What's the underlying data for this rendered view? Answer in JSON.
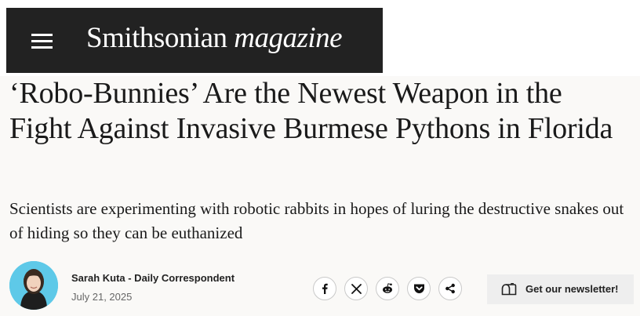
{
  "header": {
    "logo_main": "Smithsonian",
    "logo_sub": "magazine"
  },
  "article": {
    "title": "‘Robo-Bunnies’ Are the Newest Weapon in the Fight Against Invasive Burmese Pythons in Florida",
    "dek": "Scientists are experimenting with robotic rabbits in hopes of luring the destructive snakes out of hiding so they can be euthanized"
  },
  "byline": {
    "author": "Sarah Kuta - Daily Correspondent",
    "date": "July 21, 2025"
  },
  "share_icons": [
    "facebook-icon",
    "x-icon",
    "reddit-icon",
    "pocket-icon",
    "share-icon"
  ],
  "newsletter": {
    "label": "Get our newsletter!"
  },
  "colors": {
    "header_bg": "#222222",
    "content_bg": "#faf9f7",
    "avatar_bg": "#5ec9e8",
    "newsletter_bg": "#eeeeee"
  }
}
